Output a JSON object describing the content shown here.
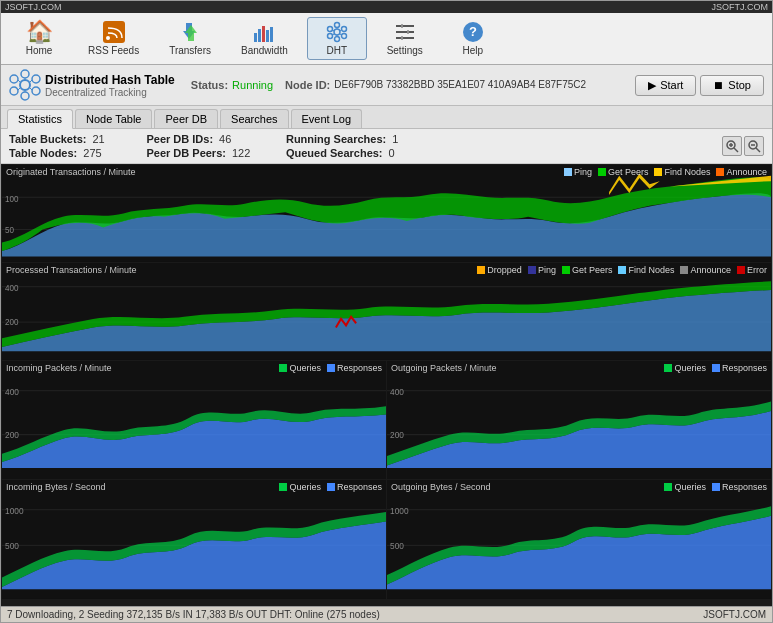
{
  "watermark": {
    "left": "JSOFTJ.COM",
    "right": "JSOFTJ.COM"
  },
  "toolbar": {
    "items": [
      {
        "id": "home",
        "label": "Home",
        "icon": "🏠"
      },
      {
        "id": "rss",
        "label": "RSS Feeds",
        "icon": "📡"
      },
      {
        "id": "transfers",
        "label": "Transfers",
        "icon": "⇅"
      },
      {
        "id": "bandwidth",
        "label": "Bandwidth",
        "icon": "📊"
      },
      {
        "id": "dht",
        "label": "DHT",
        "icon": "✦"
      },
      {
        "id": "settings",
        "label": "Settings",
        "icon": "≡"
      },
      {
        "id": "help",
        "label": "Help",
        "icon": "?"
      }
    ]
  },
  "info_bar": {
    "title": "Distributed Hash Table",
    "subtitle": "Decentralized Tracking",
    "status_label": "Status:",
    "status_value": "Running",
    "node_id_label": "Node ID:",
    "node_id_value": "DE6F790B 73382BBD 35EA1E07 410A9AB4 E87F75C2",
    "start_btn": "Start",
    "stop_btn": "Stop"
  },
  "tabs": [
    "Statistics",
    "Node Table",
    "Peer DB",
    "Searches",
    "Event Log"
  ],
  "active_tab": "Statistics",
  "stats": {
    "table_buckets_label": "Table Buckets:",
    "table_buckets_value": "21",
    "table_nodes_label": "Table Nodes:",
    "table_nodes_value": "275",
    "peer_db_ids_label": "Peer DB IDs:",
    "peer_db_ids_value": "46",
    "peer_db_peers_label": "Peer DB Peers:",
    "peer_db_peers_value": "122",
    "running_searches_label": "Running Searches:",
    "running_searches_value": "1",
    "queued_searches_label": "Queued Searches:",
    "queued_searches_value": "0"
  },
  "charts": {
    "originated": {
      "title": "Originated Transactions / Minute",
      "legend": [
        {
          "label": "Ping",
          "color": "#88ccff"
        },
        {
          "label": "Get Peers",
          "color": "#00cc00"
        },
        {
          "label": "Find Nodes",
          "color": "#ffcc00"
        },
        {
          "label": "Announce",
          "color": "#ff6600"
        }
      ],
      "y_labels": [
        "100",
        "50"
      ]
    },
    "processed": {
      "title": "Processed Transactions / Minute",
      "legend": [
        {
          "label": "Dropped",
          "color": "#ffaa00"
        },
        {
          "label": "Ping",
          "color": "#333399"
        },
        {
          "label": "Get Peers",
          "color": "#00cc00"
        },
        {
          "label": "Find Nodes",
          "color": "#66ccff"
        },
        {
          "label": "Announce",
          "color": "#888888"
        },
        {
          "label": "Error",
          "color": "#cc0000"
        }
      ],
      "y_labels": [
        "400",
        "200"
      ]
    },
    "incoming_packets": {
      "title": "Incoming Packets / Minute",
      "legend": [
        {
          "label": "Queries",
          "color": "#00cc44"
        },
        {
          "label": "Responses",
          "color": "#4488ff"
        }
      ],
      "y_labels": [
        "400",
        "200"
      ]
    },
    "outgoing_packets": {
      "title": "Outgoing Packets / Minute",
      "legend": [
        {
          "label": "Queries",
          "color": "#00cc44"
        },
        {
          "label": "Responses",
          "color": "#4488ff"
        }
      ],
      "y_labels": [
        "400",
        "200"
      ]
    },
    "incoming_bytes": {
      "title": "Incoming Bytes / Second",
      "legend": [
        {
          "label": "Queries",
          "color": "#00cc44"
        },
        {
          "label": "Responses",
          "color": "#4488ff"
        }
      ],
      "y_labels": [
        "1000",
        "500"
      ]
    },
    "outgoing_bytes": {
      "title": "Outgoing Bytes / Second",
      "legend": [
        {
          "label": "Queries",
          "color": "#00cc44"
        },
        {
          "label": "Responses",
          "color": "#4488ff"
        }
      ],
      "y_labels": [
        "1000",
        "500"
      ]
    }
  },
  "status_bar": {
    "left": "7 Downloading, 2 Seeding  372,135 B/s IN  17,383 B/s OUT   DHT: Online (275 nodes)",
    "right": "JSOFTJ.COM"
  },
  "colors": {
    "bg_dark": "#1a1a1a",
    "bg_chart": "#111111",
    "accent_blue": "#4488cc",
    "running_green": "#00aa00"
  }
}
